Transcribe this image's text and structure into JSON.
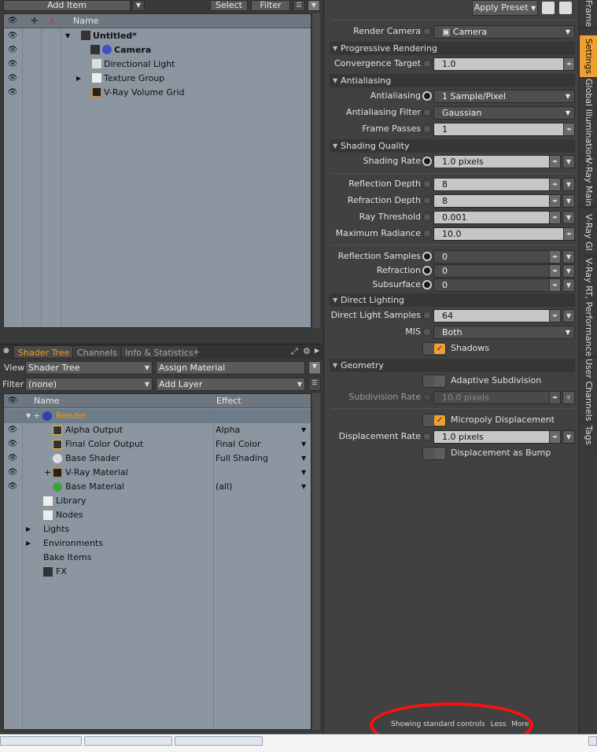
{
  "toolbar": {
    "add_item": "Add Item",
    "select": "Select",
    "filter": "Filter",
    "apply_preset": "Apply Preset"
  },
  "outliner": {
    "name_header": "Name",
    "items": [
      {
        "label": "Untitled*"
      },
      {
        "label": "Camera"
      },
      {
        "label": "Directional Light"
      },
      {
        "label": "Texture Group"
      },
      {
        "label": "V-Ray Volume Grid"
      }
    ]
  },
  "shader_panel": {
    "tabs": [
      "Shader Tree",
      "Channels",
      "Info & Statistics",
      "+"
    ],
    "view_label": "View",
    "view_value": "Shader Tree",
    "assign_material": "Assign Material",
    "filter_label": "Filter",
    "filter_value": "(none)",
    "add_layer": "Add Layer",
    "name_header": "Name",
    "effect_header": "Effect",
    "rows": [
      {
        "name": "Render",
        "effect": ""
      },
      {
        "name": "Alpha Output",
        "effect": "Alpha"
      },
      {
        "name": "Final Color Output",
        "effect": "Final Color"
      },
      {
        "name": "Base Shader",
        "effect": "Full Shading"
      },
      {
        "name": "V-Ray Material",
        "effect": ""
      },
      {
        "name": "Base Material",
        "effect": "(all)"
      }
    ],
    "folders": [
      "Library",
      "Nodes",
      "Lights",
      "Environments",
      "Bake Items",
      "FX"
    ]
  },
  "settings": {
    "render_camera_label": "Render Camera",
    "render_camera_value": "Camera",
    "progressive": "Progressive Rendering",
    "convergence_label": "Convergence Target",
    "convergence_value": "1.0",
    "antialiasing_section": "Antialiasing",
    "antialiasing_label": "Antialiasing",
    "antialiasing_value": "1 Sample/Pixel",
    "aa_filter_label": "Antialiasing Filter",
    "aa_filter_value": "Gaussian",
    "frame_passes_label": "Frame Passes",
    "frame_passes_value": "1",
    "shading_section": "Shading Quality",
    "shading_rate_label": "Shading Rate",
    "shading_rate_value": "1.0 pixels",
    "reflection_depth_label": "Reflection Depth",
    "reflection_depth_value": "8",
    "refraction_depth_label": "Refraction Depth",
    "refraction_depth_value": "8",
    "ray_threshold_label": "Ray Threshold",
    "ray_threshold_value": "0.001",
    "max_radiance_label": "Maximum Radiance",
    "max_radiance_value": "10.0",
    "refl_samples_label": "Reflection Samples",
    "refl_samples_value": "0",
    "refraction_label": "Refraction",
    "refraction_value": "0",
    "subsurface_label": "Subsurface",
    "subsurface_value": "0",
    "direct_section": "Direct Lighting",
    "dl_samples_label": "Direct Light Samples",
    "dl_samples_value": "64",
    "mis_label": "MIS",
    "mis_value": "Both",
    "shadows_label": "Shadows",
    "geometry_section": "Geometry",
    "adaptive_label": "Adaptive Subdivision",
    "subdiv_rate_label": "Subdivision Rate",
    "subdiv_rate_value": "10.0 pixels",
    "micropoly_label": "Micropoly Displacement",
    "disp_rate_label": "Displacement Rate",
    "disp_rate_value": "1.0 pixels",
    "disp_bump_label": "Displacement as Bump"
  },
  "vertical_tabs": [
    "Frame",
    "Settings",
    "Global Illumination",
    "V-Ray Main",
    "V-Ray GI",
    "V-Ray RT, Performance",
    "User Channels",
    "Tags"
  ],
  "footer": {
    "status": "Showing standard controls",
    "less": "Less",
    "more": "More"
  },
  "colors": {
    "accent": "#f0a030",
    "annotation": "#ff1010"
  }
}
